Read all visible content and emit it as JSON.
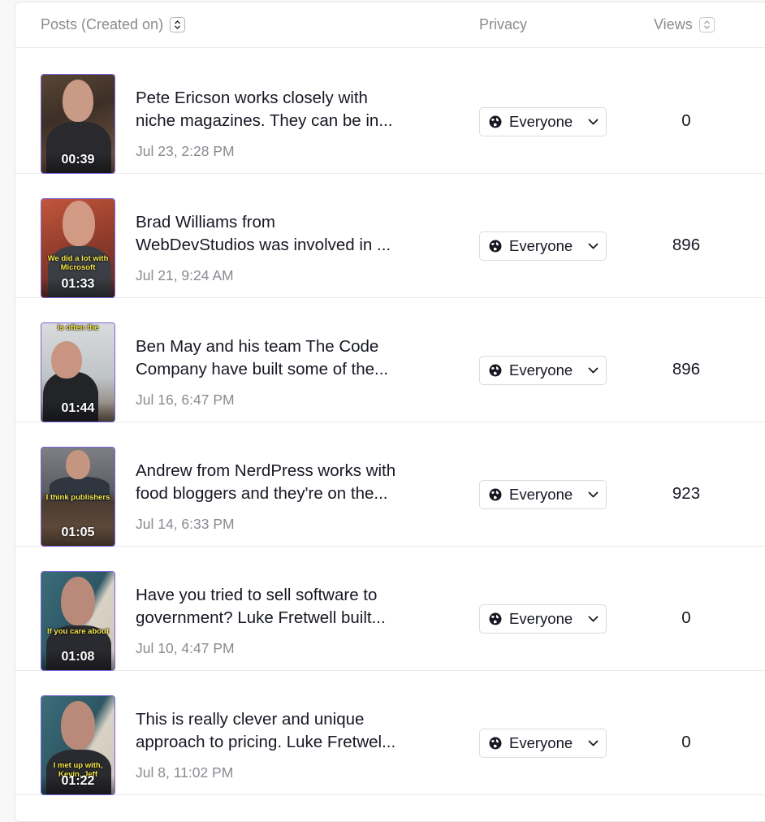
{
  "header": {
    "posts_label": "Posts (Created on)",
    "privacy_label": "Privacy",
    "views_label": "Views"
  },
  "rows": [
    {
      "title_line1": "Pete Ericson works closely with",
      "title_line2": "niche magazines. They can be in...",
      "date": "Jul 23, 2:28 PM",
      "privacy": "Everyone",
      "views": "0",
      "duration": "00:39",
      "caption": ""
    },
    {
      "title_line1": "Brad Williams from",
      "title_line2": "WebDevStudios was involved in ...",
      "date": "Jul 21, 9:24 AM",
      "privacy": "Everyone",
      "views": "896",
      "duration": "01:33",
      "caption": "We did a lot with Microsoft"
    },
    {
      "title_line1": "Ben May and his team The Code",
      "title_line2": "Company have built some of the...",
      "date": "Jul 16, 6:47 PM",
      "privacy": "Everyone",
      "views": "896",
      "duration": "01:44",
      "caption": "is often the"
    },
    {
      "title_line1": "Andrew from NerdPress works with",
      "title_line2": "food bloggers and they're on the...",
      "date": "Jul 14, 6:33 PM",
      "privacy": "Everyone",
      "views": "923",
      "duration": "01:05",
      "caption": "I think publishers"
    },
    {
      "title_line1": "Have you tried to sell software to",
      "title_line2": "government? Luke Fretwell built...",
      "date": "Jul 10, 4:47 PM",
      "privacy": "Everyone",
      "views": "0",
      "duration": "01:08",
      "caption": "If you care about"
    },
    {
      "title_line1": "This is really clever and unique",
      "title_line2": "approach to pricing. Luke Fretwel...",
      "date": "Jul 8, 11:02 PM",
      "privacy": "Everyone",
      "views": "0",
      "duration": "01:22",
      "caption": "I met up with, Kevin, Jeff"
    }
  ],
  "colors": {
    "thumb_border": "#7b63d8",
    "muted_text": "#8a8b91",
    "caption_yellow": "#f6e94a"
  },
  "icons": {
    "sort": "sort-icon",
    "privacy": "globe-icon",
    "dropdown": "chevron-down-icon"
  }
}
